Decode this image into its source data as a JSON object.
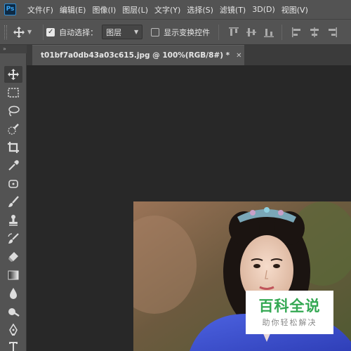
{
  "app": {
    "logo_text": "Ps"
  },
  "menu": [
    {
      "label": "文件(F)"
    },
    {
      "label": "编辑(E)"
    },
    {
      "label": "图像(I)"
    },
    {
      "label": "图层(L)"
    },
    {
      "label": "文字(Y)"
    },
    {
      "label": "选择(S)"
    },
    {
      "label": "滤镜(T)"
    },
    {
      "label": "3D(D)"
    },
    {
      "label": "视图(V)"
    }
  ],
  "options_bar": {
    "auto_select_label": "自动选择：",
    "auto_select_checked": true,
    "target_value": "图层",
    "show_transform_label": "显示变换控件",
    "show_transform_checked": false
  },
  "document": {
    "tab_label": "t01bf7a0db43a03c615.jpg @ 100%(RGB/8#) *"
  },
  "watermark": {
    "title": "百科全说",
    "subtitle": "助你轻松解决"
  },
  "colors": {
    "ui_panel": "#535353",
    "canvas_bg": "#282828",
    "accent_ps": "#31a8ff",
    "watermark_green": "#34a853"
  },
  "tools": [
    "move-tool-icon",
    "marquee-tool-icon",
    "lasso-tool-icon",
    "quick-select-tool-icon",
    "crop-tool-icon",
    "eyedropper-tool-icon",
    "healing-brush-tool-icon",
    "brush-tool-icon",
    "clone-stamp-tool-icon",
    "history-brush-tool-icon",
    "eraser-tool-icon",
    "gradient-tool-icon",
    "blur-tool-icon",
    "dodge-tool-icon",
    "pen-tool-icon",
    "type-tool-icon"
  ]
}
